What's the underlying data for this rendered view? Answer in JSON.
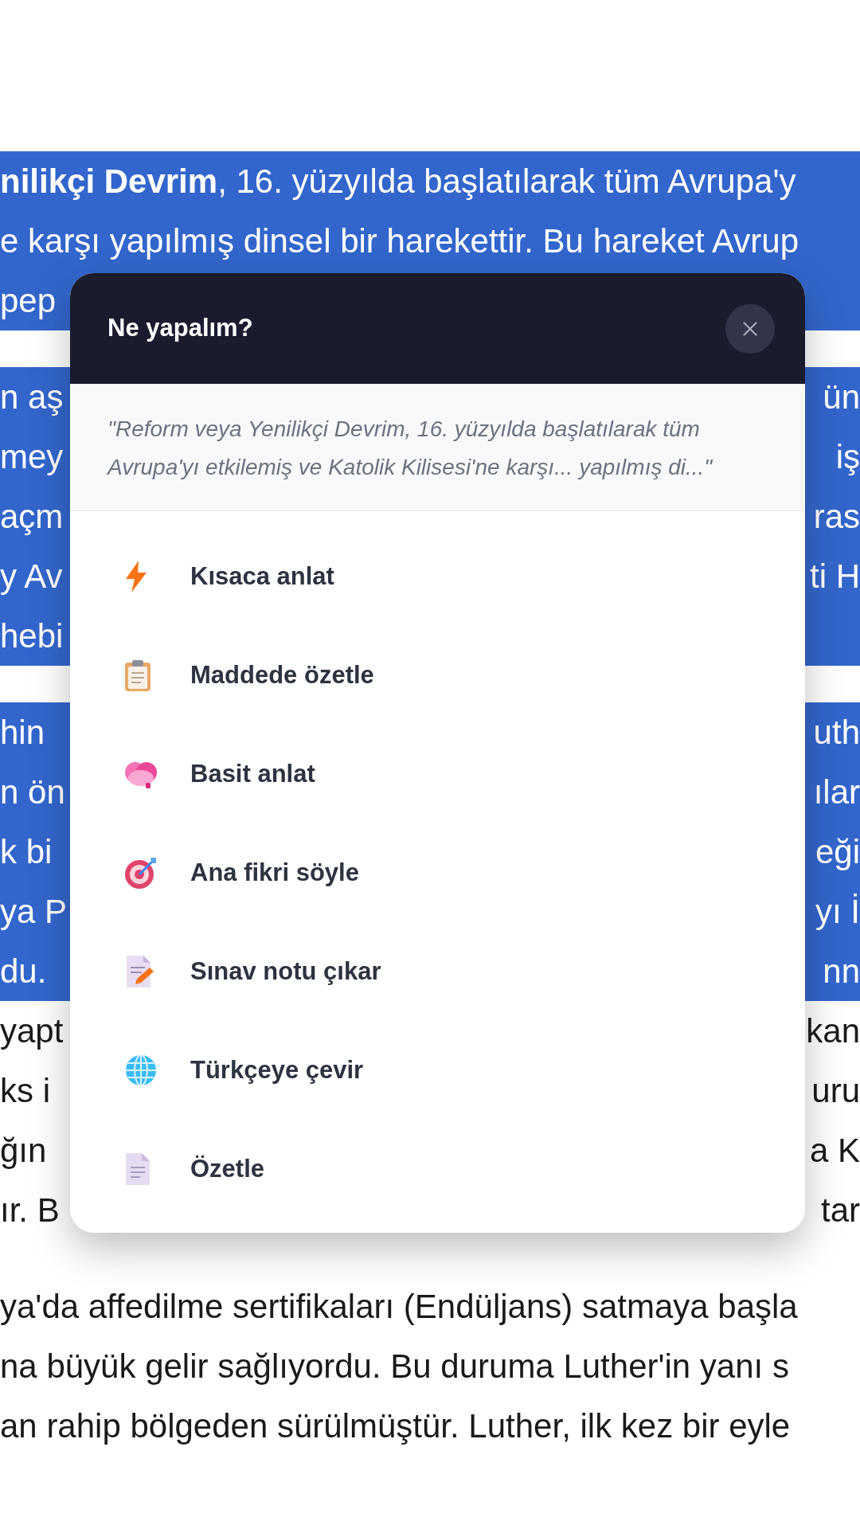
{
  "paragraphs": [
    {
      "lines": [
        {
          "left": "**nilikçi Devrim**, 16. yüzyılda başlatılarak tüm Avrupa'y",
          "highlighted": true
        },
        {
          "left": "e karşı yapılmış dinsel bir harekettir. Bu hareket Avrup",
          "highlighted": true
        },
        {
          "left": "pep",
          "highlighted": true
        }
      ]
    },
    {
      "lines": [
        {
          "left": "n aş",
          "right": "ün",
          "highlighted": true
        },
        {
          "left": "mey",
          "right": "iş",
          "highlighted": true
        },
        {
          "left": "açm",
          "right": "ras",
          "highlighted": true
        },
        {
          "left": "y Av",
          "right": "ti H",
          "highlighted": true
        },
        {
          "left": "hebi",
          "highlighted": true
        }
      ]
    },
    {
      "lines": [
        {
          "left": "hin",
          "right": "uth",
          "highlighted": true
        },
        {
          "left": "n ön",
          "right": "ılar",
          "highlighted": true
        },
        {
          "left": "k bi",
          "right": "eği",
          "highlighted": true
        },
        {
          "left": "ya P",
          "right": "yı İ",
          "highlighted": true
        },
        {
          "left": "du.",
          "right": "nn",
          "highlighted": true
        },
        {
          "left": "yapt",
          "right": "kan",
          "highlighted": false
        },
        {
          "left": "ks i",
          "right": "uru",
          "highlighted": false
        },
        {
          "left": "ğın",
          "right": "a K",
          "highlighted": false
        },
        {
          "left": "ır. B",
          "right": "tar",
          "highlighted": false
        }
      ]
    },
    {
      "lines": [
        {
          "left": "ya'da affedilme sertifikaları (Endüljans) satmaya başla",
          "highlighted": false
        },
        {
          "left": "na büyük gelir sağlıyordu. Bu duruma Luther'in yanı s",
          "highlighted": false
        },
        {
          "left": "an rahip bölgeden sürülmüştür. Luther, ilk kez bir eyle",
          "highlighted": false
        }
      ]
    }
  ],
  "dialog": {
    "title": "Ne yapalım?",
    "quote": "\"Reform veya Yenilikçi Devrim, 16. yüzyılda başlatılarak tüm Avrupa'yı etkilemiş ve Katolik Kilisesi'ne karşı... yapılmış di...\"",
    "actions": [
      {
        "label": "Kısaca anlat"
      },
      {
        "label": "Maddede özetle"
      },
      {
        "label": "Basit anlat"
      },
      {
        "label": "Ana fikri söyle"
      },
      {
        "label": "Sınav notu çıkar"
      },
      {
        "label": "Türkçeye çevir"
      },
      {
        "label": "Özetle"
      }
    ]
  }
}
